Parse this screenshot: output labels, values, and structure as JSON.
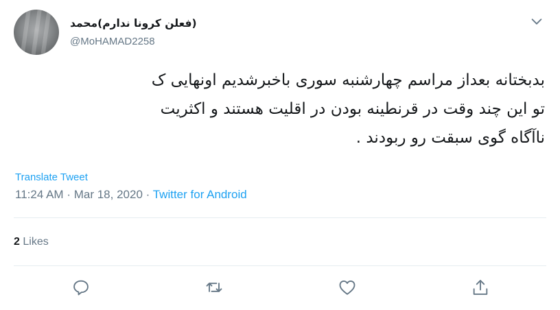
{
  "tweet": {
    "author_name": "(فعلن کرونا ندارم)محمد",
    "author_handle": "@MoHAMAD2258",
    "text_lines": [
      "بدبختانه بعداز مراسم چهارشنبه سوری باخبرشدیم اونهایی ک",
      "تو این چند وقت در قرنطینه بودن در اقلیت هستند و اکثریت",
      "ناآگاه گوی سبقت رو ربودند ."
    ],
    "translate_label": "Translate Tweet",
    "time": "11:24 AM",
    "separator": "·",
    "date": "Mar 18, 2020",
    "source": "Twitter for Android",
    "likes_count": "2",
    "likes_label": "Likes"
  },
  "colors": {
    "accent": "#1da1f2",
    "secondary_text": "#657786",
    "divider": "#e6ecf0"
  },
  "icons": {
    "menu": "chevron-down-icon",
    "reply": "reply-icon",
    "retweet": "retweet-icon",
    "like": "heart-icon",
    "share": "share-icon"
  }
}
